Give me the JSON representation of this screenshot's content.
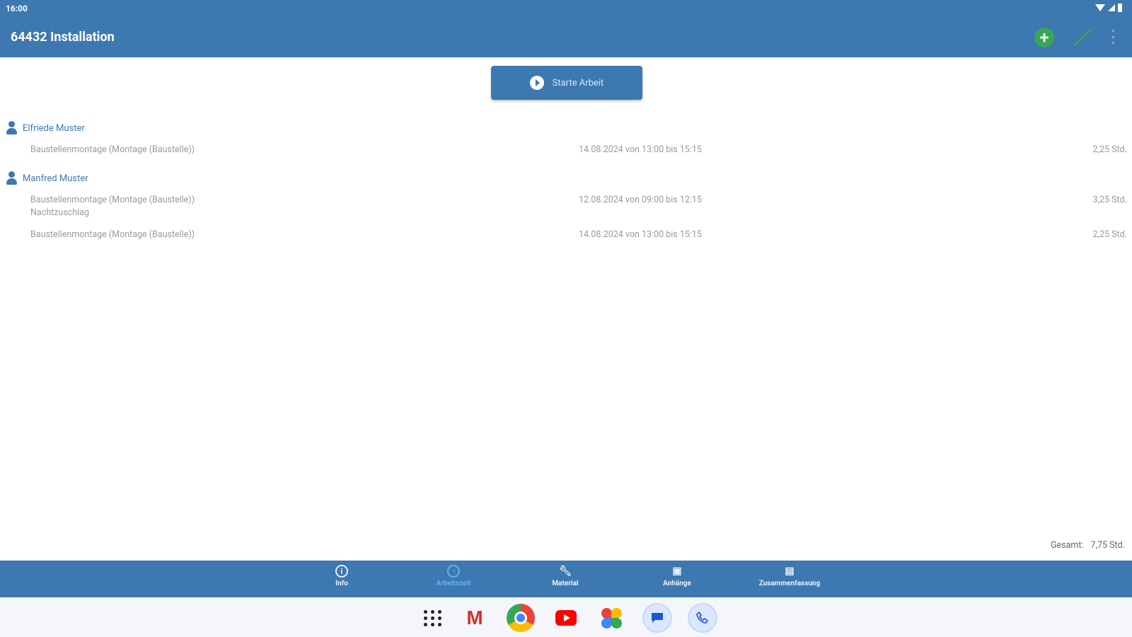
{
  "status_bar": {
    "time": "16:00"
  },
  "app_bar": {
    "title": "64432 Installation",
    "add_icon": "plus-circle-icon",
    "edit_icon": "pencil-icon",
    "more_icon": "more-vert-icon"
  },
  "start_button": {
    "label": "Starte Arbeit",
    "icon": "play-icon"
  },
  "workers": [
    {
      "name": "Elfriede Muster",
      "entries": [
        {
          "description": "Baustellenmontage (Montage (Baustelle))",
          "time": "14.08.2024 von 13:00 bis 15:15",
          "hours": "2,25 Std."
        }
      ]
    },
    {
      "name": "Manfred Muster",
      "entries": [
        {
          "description": "Baustellenmontage (Montage (Baustelle))",
          "note": "Nachtzuschlag",
          "time": "12.08.2024 von 09:00 bis 12:15",
          "hours": "3,25 Std."
        },
        {
          "description": "Baustellenmontage (Montage (Baustelle))",
          "time": "14.08.2024 von 13:00 bis 15:15",
          "hours": "2,25 Std."
        }
      ]
    }
  ],
  "total": {
    "label": "Gesamt:",
    "value": "7,75 Std."
  },
  "bottom_nav": {
    "active": "Arbeitszeit",
    "items": [
      {
        "label": "Info",
        "icon": "info-icon"
      },
      {
        "label": "Arbeitszeit",
        "icon": "clock-icon"
      },
      {
        "label": "Material",
        "icon": "wrench-icon"
      },
      {
        "label": "Anhänge",
        "icon": "attachment-icon"
      },
      {
        "label": "Zusammenfassung",
        "icon": "summary-icon"
      }
    ]
  },
  "dock": {
    "apps": [
      "app-drawer-icon",
      "gmail-icon",
      "chrome-icon",
      "youtube-icon",
      "photos-icon",
      "messages-icon",
      "phone-icon"
    ]
  },
  "colors": {
    "primary": "#3d78b1",
    "accent_green": "#3aa655",
    "active_tab": "#5fb1f5",
    "secondary_text": "#9a9a9a"
  }
}
